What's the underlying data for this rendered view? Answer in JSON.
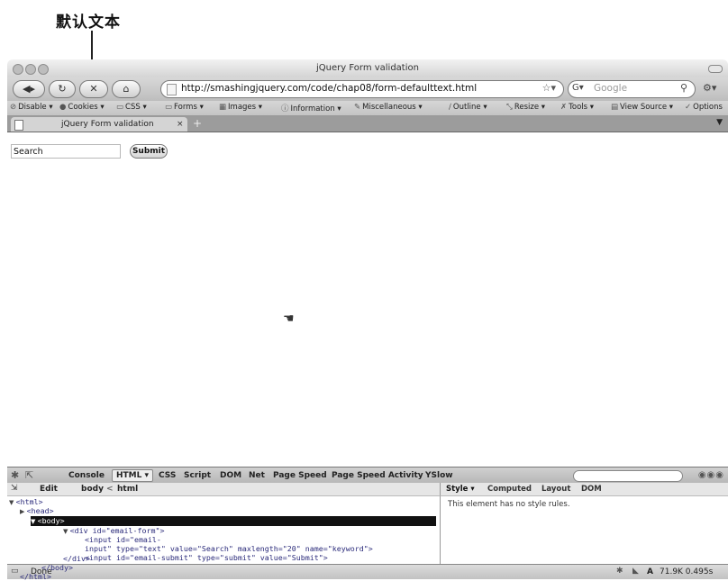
{
  "annotation": {
    "text": "默认文本"
  },
  "window": {
    "title": "jQuery Form validation"
  },
  "navbar": {
    "back_icon": "back-arrow-icon",
    "url": "http://smashingjquery.com/code/chap08/form-defaulttext.html",
    "search_placeholder": "Google"
  },
  "toolbar": {
    "items": [
      "Disable",
      "Cookies",
      "CSS",
      "Forms",
      "Images",
      "Information",
      "Miscellaneous",
      "Outline",
      "Resize",
      "Tools",
      "View Source",
      "Options"
    ]
  },
  "tab": {
    "title": "jQuery Form validation",
    "new_tab": "+"
  },
  "page": {
    "input_value": "Search",
    "submit_label": "Submit"
  },
  "firebug": {
    "tabs": [
      "Console",
      "HTML",
      "CSS",
      "Script",
      "DOM",
      "Net",
      "Page Speed",
      "Page Speed Activity",
      "YSlow"
    ],
    "edit_label": "Edit",
    "breadcrumb": [
      "body",
      "html"
    ],
    "side_tabs": [
      "Style",
      "Computed",
      "Layout",
      "DOM"
    ],
    "side_message": "This element has no style rules.",
    "code_lines": [
      "<html>",
      "<head>",
      "<body>",
      "<div id=\"email-form\">",
      "<input id=\"email-",
      "input\" type=\"text\" value=\"Search\" maxlength=\"20\" name=\"keyword\">",
      "<input id=\"email-submit\" type=\"submit\" value=\"Submit\">",
      "</div>",
      "</body>",
      "</html>"
    ]
  },
  "status": {
    "text": "Done",
    "right_text": "71.9K  0.495s"
  }
}
